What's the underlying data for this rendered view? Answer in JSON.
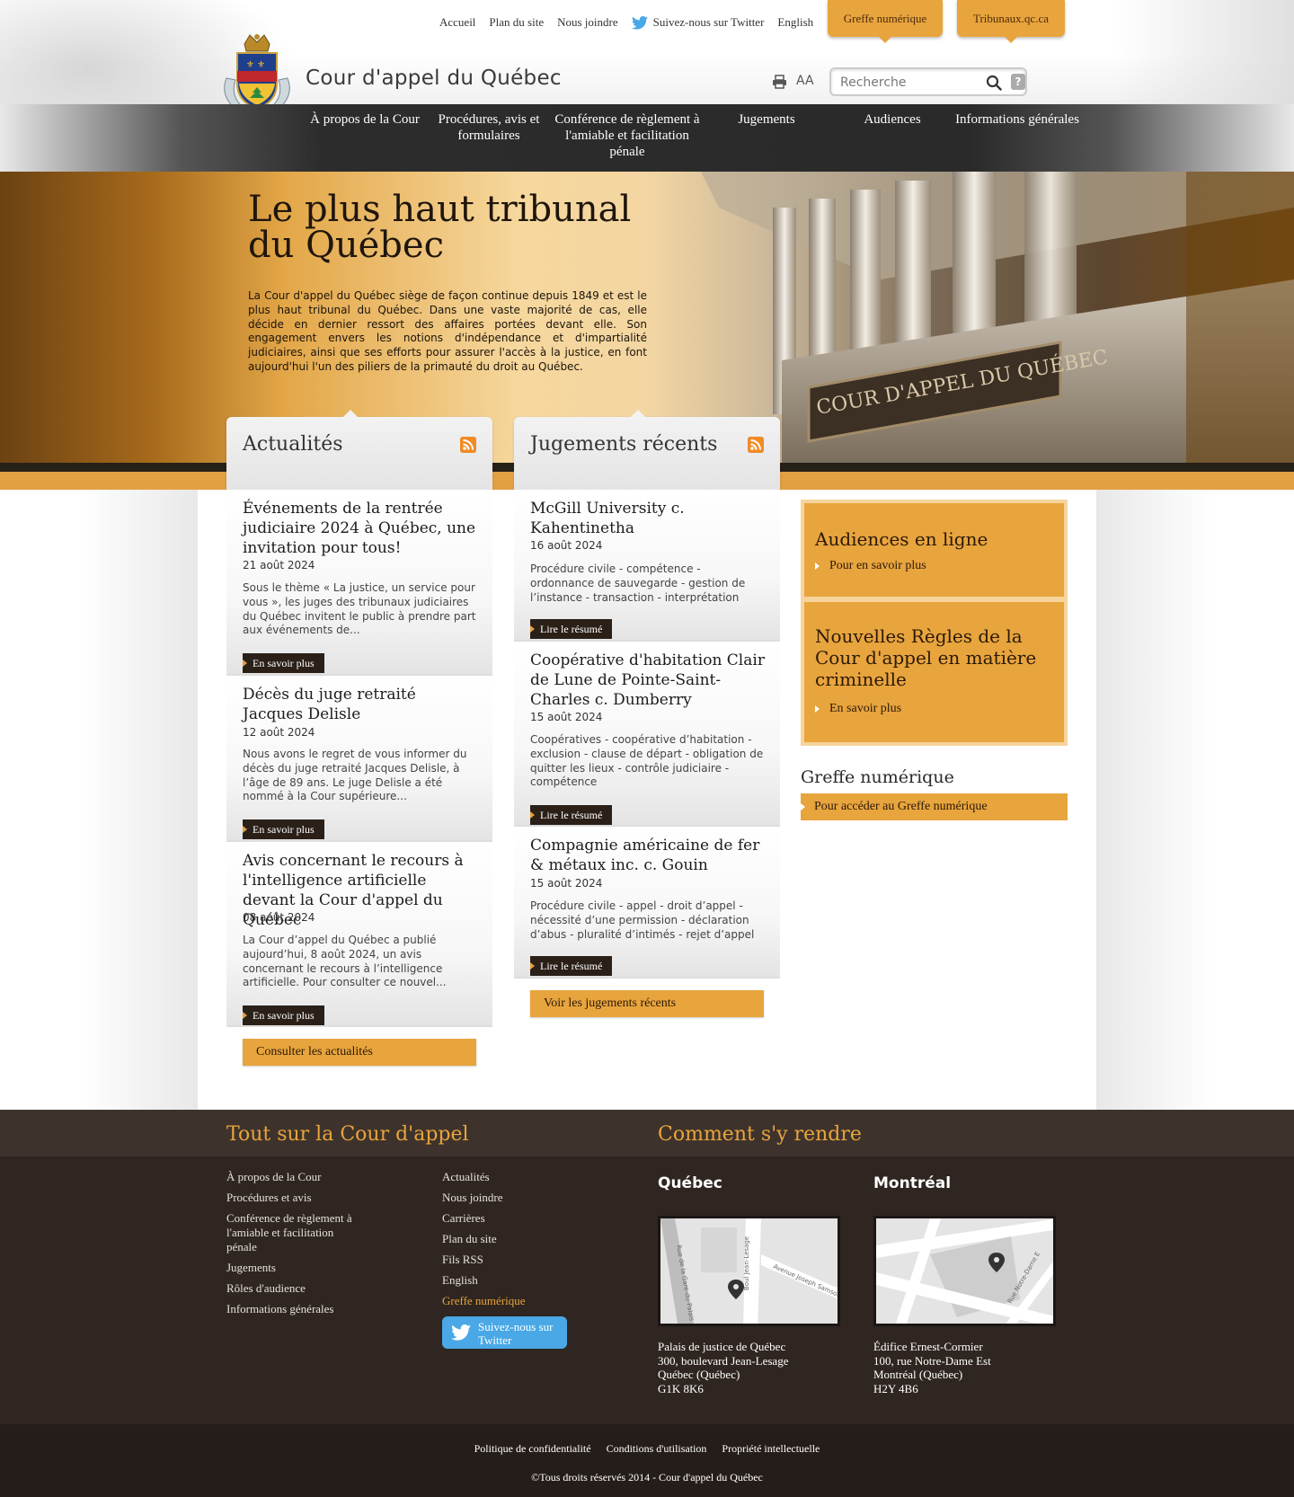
{
  "header": {
    "toplinks": [
      "Accueil",
      "Plan du site",
      "Nous joindre"
    ],
    "twitter_label": "Suivez-nous sur Twitter",
    "english_label": "English",
    "tab_greffe": "Greffe numérique",
    "tab_tribunaux": "Tribunaux.qc.ca",
    "site_title": "Cour d'appel du Québec",
    "font_size_label": "AA",
    "search_placeholder": "Recherche",
    "help_label": "?"
  },
  "nav": {
    "items": [
      "À propos de la Cour",
      "Procédures, avis et formulaires",
      "Conférence de règlement à l'amiable et facilitation pénale",
      "Jugements",
      "Audiences",
      "Informations générales"
    ]
  },
  "hero": {
    "title": "Le plus haut tribunal du Québec",
    "text": "La Cour d'appel du Québec siège de façon continue depuis 1849 et est le plus haut tribunal du Québec. Dans une vaste majorité de cas, elle décide en dernier ressort des affaires portées devant elle. Son engagement envers les notions d'indépendance et d'impartialité judiciaires, ainsi que ses efforts pour assurer l'accès à la justice, en font aujourd'hui l'un des piliers de la primauté du droit au Québec.",
    "plaque_text": "COUR D'APPEL DU QUÉBEC"
  },
  "news": {
    "heading": "Actualités",
    "more_label": "En savoir plus",
    "items": [
      {
        "title": "Événements de la rentrée judiciaire 2024 à Québec, une invitation pour tous!",
        "date": "21 août 2024",
        "text": "Sous le thème « La justice, un service pour vous », les juges des tribunaux judiciaires du Québec invitent le public à prendre part aux événements de..."
      },
      {
        "title": "Décès du juge retraité Jacques Delisle",
        "date": "12 août 2024",
        "text": "Nous avons le regret de vous informer du décès du juge retraité Jacques Delisle, à l’âge de 89 ans. Le juge Delisle a été nommé à la Cour supérieure..."
      },
      {
        "title": "Avis concernant le recours à l'intelligence artificielle devant la Cour d'appel du Québec",
        "date": "08 août 2024",
        "text": "La Cour d’appel du Québec a publié aujourd’hui, 8 août 2024, un avis concernant le recours à l’intelligence artificielle. Pour consulter ce nouvel..."
      }
    ],
    "all_label": "Consulter les actualités"
  },
  "judgments": {
    "heading": "Jugements récents",
    "more_label": "Lire le résumé",
    "items": [
      {
        "title": "McGill University c. Kahentinetha",
        "date": "16 août 2024",
        "text": "Procédure civile - compétence - ordonnance de sauvegarde - gestion de l’instance - transaction - interprétation"
      },
      {
        "title": "Coopérative d'habitation Clair de Lune de Pointe-Saint-Charles c. Dumberry",
        "date": "15 août 2024",
        "text": "Coopératives - coopérative d’habitation - exclusion - clause de départ - obligation de quitter les lieux - contrôle judiciaire - compétence"
      },
      {
        "title": "Compagnie américaine de fer & métaux inc. c. Gouin",
        "date": "15 août 2024",
        "text": "Procédure civile - appel - droit d’appel - nécessité d’une permission - déclaration d’abus - pluralité d’intimés - rejet d’appel"
      }
    ],
    "all_label": "Voir les jugements récents"
  },
  "sidebar": {
    "promo1_title": "Audiences en ligne",
    "promo1_link": "Pour en savoir plus",
    "promo2_title": "Nouvelles Règles de la Cour d'appel en matière criminelle",
    "promo2_link": "En savoir plus",
    "greffe_title": "Greffe numérique",
    "greffe_link": "Pour accéder au Greffe numérique"
  },
  "footer": {
    "about_heading": "Tout sur la Cour d'appel",
    "col1": [
      "À propos de la Cour",
      "Procédures et avis",
      "Conférence de règlement à l'amiable et facilitation pénale",
      "Jugements",
      "Rôles d'audience",
      "Informations générales"
    ],
    "col2": [
      "Actualités",
      "Nous joindre",
      "Carrières",
      "Plan du site",
      "Fils RSS",
      "English"
    ],
    "col2_accent": "Greffe numérique",
    "twitter_label": "Suivez-nous sur Twitter",
    "directions_heading": "Comment s'y rendre",
    "quebec": {
      "city": "Québec",
      "lines": [
        "Palais de justice de Québec",
        "300, boulevard Jean-Lesage",
        "Québec (Québec)",
        "G1K 8K6"
      ],
      "streets": [
        "Rue de la Gare-du-Palais",
        "Boul Jean-Lesage",
        "Avenue Joseph Samson"
      ]
    },
    "montreal": {
      "city": "Montréal",
      "lines": [
        "Édifice Ernest-Cormier",
        "100, rue Notre-Dame Est",
        "Montréal (Québec)",
        "H2Y 4B6"
      ],
      "streets": [
        "Rue Notre-Dame E"
      ]
    },
    "legal_links": [
      "Politique de confidentialité",
      "Conditions d'utilisation",
      "Propriété intellectuelle"
    ],
    "copyright": "©Tous droits réservés 2014 - Cour d'appel du Québec"
  },
  "colors": {
    "accent": "#e8a43d",
    "nav_dark": "#2a2a2a",
    "footer_bg": "#2f2621",
    "twitter": "#4aa8e6"
  }
}
